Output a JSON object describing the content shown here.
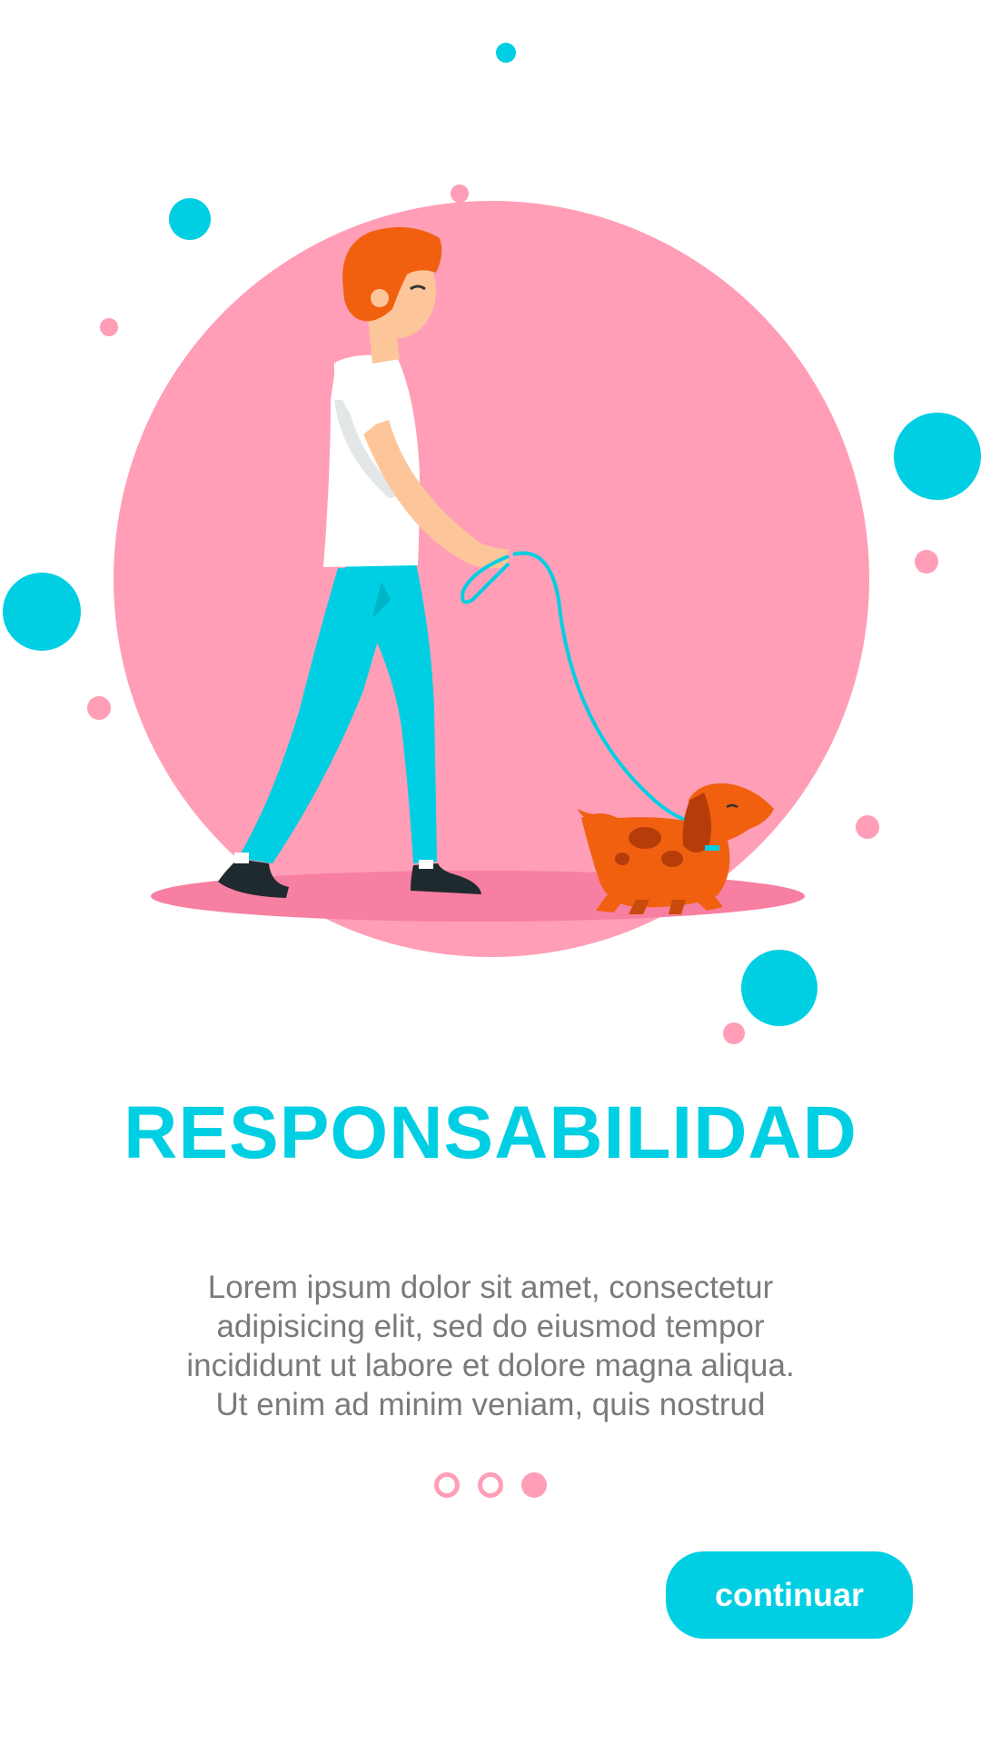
{
  "colors": {
    "accent": "#00CFE3",
    "pink": "#FF9EB6",
    "text": "#7a7a7a"
  },
  "onboarding": {
    "title": "RESPONSABILIDAD",
    "body_lines": [
      "Lorem ipsum dolor sit amet, consectetur",
      "adipisicing elit, sed do eiusmod tempor",
      "incididunt ut labore et dolore magna aliqua.",
      "Ut enim ad minim veniam, quis nostrud"
    ],
    "pager": {
      "total": 3,
      "current": 3
    },
    "continue_label": "continuar"
  },
  "illustration": {
    "icon": "man-walking-dog-illustration"
  }
}
